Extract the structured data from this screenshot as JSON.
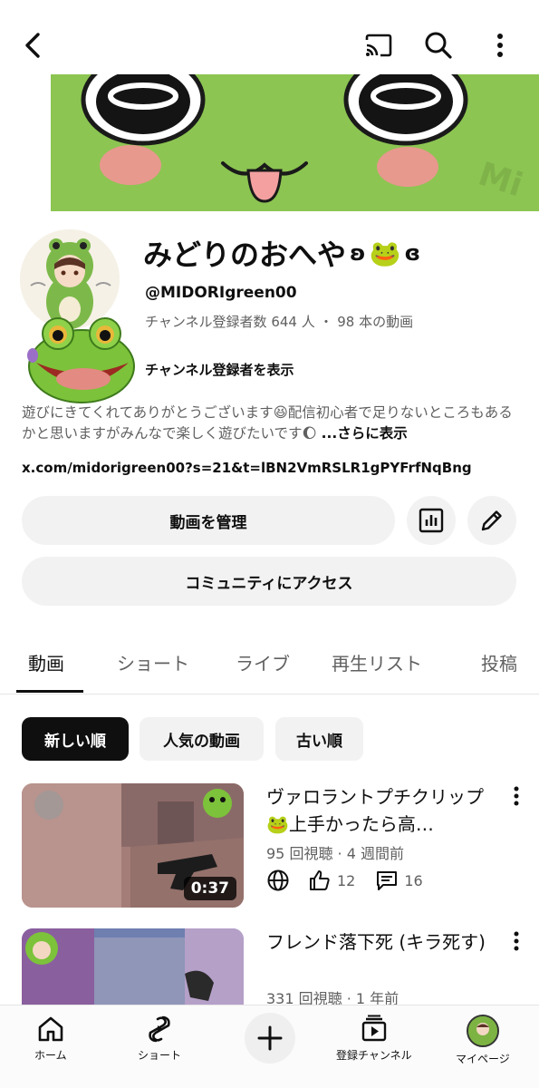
{
  "topbar": {
    "back_icon": "back-arrow-icon",
    "cast_icon": "cast-icon",
    "search_icon": "search-icon",
    "more_icon": "more-vert-icon"
  },
  "channel": {
    "name": "みどりのおへや",
    "name_deco_left": "ʚ",
    "name_emoji": "🐸",
    "name_deco_right": "ɞ",
    "handle": "@MIDORIgreen00",
    "meta": "チャンネル登録者数 644 人 ・ 98 本の動画",
    "show_subscribers": "チャンネル登録者を表示",
    "description": "遊びにきてくれてありがとうございます😆配信初心者で足りないところもあるかと思いますがみんなで楽しく遊びたいです🌔",
    "description_more": "...さらに表示",
    "link": "x.com/midorigreen00?s=21&t=lBN2VmRSLR1gPYFrfNqBng"
  },
  "actions": {
    "manage_videos": "動画を管理",
    "community": "コミュニティにアクセス",
    "analytics_icon": "analytics-icon",
    "edit_icon": "pencil-icon"
  },
  "tabs": [
    {
      "label": "動画",
      "active": true
    },
    {
      "label": "ショート",
      "active": false
    },
    {
      "label": "ライブ",
      "active": false
    },
    {
      "label": "再生リスト",
      "active": false
    },
    {
      "label": "投稿",
      "active": false
    }
  ],
  "chips": [
    {
      "label": "新しい順",
      "active": true
    },
    {
      "label": "人気の動画",
      "active": false
    },
    {
      "label": "古い順",
      "active": false
    }
  ],
  "videos": [
    {
      "title": "ヴァロラントプチクリップ🐸上手かったら高…",
      "meta": "95 回視聴 · 4 週間前",
      "duration": "0:37",
      "likes": "12",
      "comments": "16"
    },
    {
      "title": "フレンド落下死 (キラ死す)",
      "meta": "331 回視聴 · 1 年前"
    }
  ],
  "bottom_nav": [
    {
      "label": "ホーム",
      "icon": "home-icon"
    },
    {
      "label": "ショート",
      "icon": "shorts-icon"
    },
    {
      "label": "",
      "icon": "plus-icon"
    },
    {
      "label": "登録チャンネル",
      "icon": "subscriptions-icon"
    },
    {
      "label": "マイページ",
      "icon": "avatar-icon"
    }
  ]
}
